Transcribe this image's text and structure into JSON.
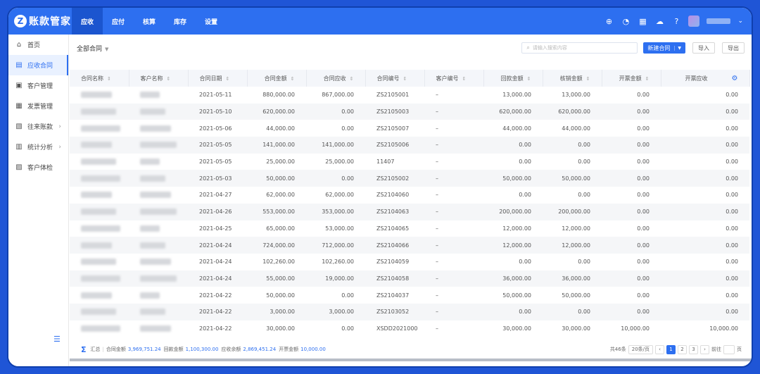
{
  "app": {
    "logo_letter": "Z",
    "name": "账款管家"
  },
  "nav": [
    "应收",
    "应付",
    "核算",
    "库存",
    "设置"
  ],
  "sidebar": [
    {
      "icon": "home-icon",
      "glyph": "⌂",
      "label": "首页",
      "arrow": false
    },
    {
      "icon": "document-icon",
      "glyph": "▤",
      "label": "应收合同",
      "arrow": false,
      "active": true
    },
    {
      "icon": "customer-icon",
      "glyph": "▣",
      "label": "客户管理",
      "arrow": false
    },
    {
      "icon": "invoice-icon",
      "glyph": "▦",
      "label": "发票管理",
      "arrow": false
    },
    {
      "icon": "ledger-icon",
      "glyph": "▧",
      "label": "往来账款",
      "arrow": true
    },
    {
      "icon": "chart-icon",
      "glyph": "▥",
      "label": "统计分析",
      "arrow": true
    },
    {
      "icon": "checkup-icon",
      "glyph": "▨",
      "label": "客户体检",
      "arrow": false
    }
  ],
  "toolbar": {
    "filter": "全部合同",
    "search_placeholder": "请输入搜索内容",
    "new_label": "新建合同",
    "import_label": "导入",
    "export_label": "导出"
  },
  "columns": [
    "合同名称",
    "客户名称",
    "合同日期",
    "合同金额",
    "合同应收",
    "合同编号",
    "客户编号",
    "回款金额",
    "核销金额",
    "开票金额",
    "开票应收"
  ],
  "rows": [
    [
      "2021-05-11",
      "880,000.00",
      "867,000.00",
      "ZS2105001",
      "–",
      "13,000.00",
      "13,000.00",
      "0.00",
      "0.00"
    ],
    [
      "2021-05-10",
      "620,000.00",
      "0.00",
      "ZS2105003",
      "–",
      "620,000.00",
      "620,000.00",
      "0.00",
      "0.00"
    ],
    [
      "2021-05-06",
      "44,000.00",
      "0.00",
      "ZS2105007",
      "–",
      "44,000.00",
      "44,000.00",
      "0.00",
      "0.00"
    ],
    [
      "2021-05-05",
      "141,000.00",
      "141,000.00",
      "ZS2105006",
      "–",
      "0.00",
      "0.00",
      "0.00",
      "0.00"
    ],
    [
      "2021-05-05",
      "25,000.00",
      "25,000.00",
      "11407",
      "–",
      "0.00",
      "0.00",
      "0.00",
      "0.00"
    ],
    [
      "2021-05-03",
      "50,000.00",
      "0.00",
      "ZS2105002",
      "–",
      "50,000.00",
      "50,000.00",
      "0.00",
      "0.00"
    ],
    [
      "2021-04-27",
      "62,000.00",
      "62,000.00",
      "ZS2104060",
      "–",
      "0.00",
      "0.00",
      "0.00",
      "0.00"
    ],
    [
      "2021-04-26",
      "553,000.00",
      "353,000.00",
      "ZS2104063",
      "–",
      "200,000.00",
      "200,000.00",
      "0.00",
      "0.00"
    ],
    [
      "2021-04-25",
      "65,000.00",
      "53,000.00",
      "ZS2104065",
      "–",
      "12,000.00",
      "12,000.00",
      "0.00",
      "0.00"
    ],
    [
      "2021-04-24",
      "724,000.00",
      "712,000.00",
      "ZS2104066",
      "–",
      "12,000.00",
      "12,000.00",
      "0.00",
      "0.00"
    ],
    [
      "2021-04-24",
      "102,260.00",
      "102,260.00",
      "ZS2104059",
      "–",
      "0.00",
      "0.00",
      "0.00",
      "0.00"
    ],
    [
      "2021-04-24",
      "55,000.00",
      "19,000.00",
      "ZS2104058",
      "–",
      "36,000.00",
      "36,000.00",
      "0.00",
      "0.00"
    ],
    [
      "2021-04-22",
      "50,000.00",
      "0.00",
      "ZS2104037",
      "–",
      "50,000.00",
      "50,000.00",
      "0.00",
      "0.00"
    ],
    [
      "2021-04-22",
      "3,000.00",
      "3,000.00",
      "ZS2103052",
      "–",
      "0.00",
      "0.00",
      "0.00",
      "0.00"
    ],
    [
      "2021-04-22",
      "30,000.00",
      "0.00",
      "XSDD2021000",
      "–",
      "30,000.00",
      "30,000.00",
      "10,000.00",
      "10,000.00"
    ]
  ],
  "footer": {
    "summary_label": "汇总",
    "items": [
      {
        "label": "合同金额",
        "value": "3,969,751.24"
      },
      {
        "label": "回款金额",
        "value": "1,100,300.00"
      },
      {
        "label": "应收余额",
        "value": "2,869,451.24"
      },
      {
        "label": "开票金额",
        "value": "10,000.00"
      }
    ],
    "total": "共46条",
    "page_size": "20条/页",
    "pages": [
      "1",
      "2",
      "3"
    ],
    "goto": "前往",
    "page_unit": "页"
  }
}
